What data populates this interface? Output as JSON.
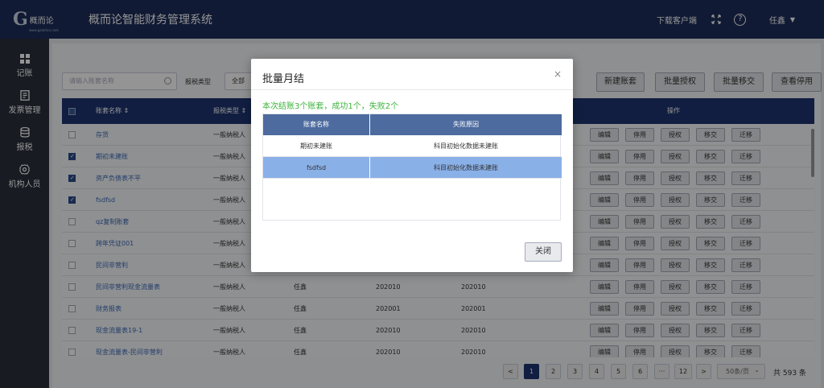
{
  "header": {
    "logo_mark": "G",
    "logo_text": "概而论",
    "logo_url": "www.gaierlun.com",
    "title": "概而论智能财务管理系统",
    "download": "下载客户端",
    "help": "?",
    "user": "任鑫",
    "caret": "▼"
  },
  "sidebar": {
    "items": [
      {
        "label": "记账",
        "icon": "grid-icon"
      },
      {
        "label": "发票管理",
        "icon": "document-icon"
      },
      {
        "label": "报税",
        "icon": "database-icon"
      },
      {
        "label": "机构人员",
        "icon": "gear-icon"
      }
    ]
  },
  "toolbar": {
    "search_placeholder": "请输入账套名称",
    "filter_label": "报税类型",
    "filter_value": "全部",
    "buttons": [
      "新建账套",
      "批量授权",
      "批量移交",
      "查看停用"
    ]
  },
  "table": {
    "headers": {
      "name": "账套名称 ⇕",
      "tax_type": "报税类型 ⇕",
      "ops": "操作"
    },
    "op_labels": [
      "编辑",
      "停用",
      "授权",
      "移交",
      "迁移"
    ],
    "rows": [
      {
        "checked": false,
        "name": "存货",
        "tax": "一般纳税人",
        "owner": "",
        "start": "",
        "current": ""
      },
      {
        "checked": true,
        "name": "期初未建账",
        "tax": "一般纳税人",
        "owner": "",
        "start": "",
        "current": ""
      },
      {
        "checked": true,
        "name": "资产负债表不平",
        "tax": "一般纳税人",
        "owner": "",
        "start": "",
        "current": ""
      },
      {
        "checked": true,
        "name": "fsdfsd",
        "tax": "一般纳税人",
        "owner": "",
        "start": "",
        "current": ""
      },
      {
        "checked": false,
        "name": "qz复制账套",
        "tax": "一般纳税人",
        "owner": "",
        "start": "",
        "current": ""
      },
      {
        "checked": false,
        "name": "跨年凭证001",
        "tax": "一般纳税人",
        "owner": "",
        "start": "",
        "current": ""
      },
      {
        "checked": false,
        "name": "民间非营利",
        "tax": "一般纳税人",
        "owner": "",
        "start": "",
        "current": ""
      },
      {
        "checked": false,
        "name": "民间非营利现金流量表",
        "tax": "一般纳税人",
        "owner": "任鑫",
        "start": "202010",
        "current": "202010"
      },
      {
        "checked": false,
        "name": "财务报表",
        "tax": "一般纳税人",
        "owner": "任鑫",
        "start": "202001",
        "current": "202001"
      },
      {
        "checked": false,
        "name": "现金流量表19-1",
        "tax": "一般纳税人",
        "owner": "任鑫",
        "start": "202010",
        "current": "202010"
      },
      {
        "checked": false,
        "name": "现金流量表-民间非营利",
        "tax": "一般纳税人",
        "owner": "任鑫",
        "start": "202010",
        "current": "202010"
      }
    ]
  },
  "pagination": {
    "prev": "<",
    "pages": [
      "1",
      "2",
      "3",
      "4",
      "5",
      "6",
      "···",
      "12"
    ],
    "next": ">",
    "page_size": "50条/页",
    "page_size_caret": "⌄",
    "total": "共 593 条"
  },
  "modal": {
    "title": "批量月结",
    "close_x": "×",
    "summary": "本次结账3个账套，成功1个，失败2个",
    "col_name": "账套名称",
    "col_reason": "失败原因",
    "rows": [
      {
        "name": "期初未建账",
        "reason": "科目初始化数据未建账",
        "selected": false
      },
      {
        "name": "fsdfsd",
        "reason": "科目初始化数据未建账",
        "selected": true
      }
    ],
    "close_button": "关闭"
  },
  "colors": {
    "header_bg": "#1e2d5a",
    "sidebar_bg": "#2a2f3b",
    "table_head_bg": "#1e3470",
    "modal_table_head": "#4d6b9f",
    "selected_row": "#8ab0e8",
    "success_text": "#3cb43c",
    "link": "#3a6ab8"
  }
}
